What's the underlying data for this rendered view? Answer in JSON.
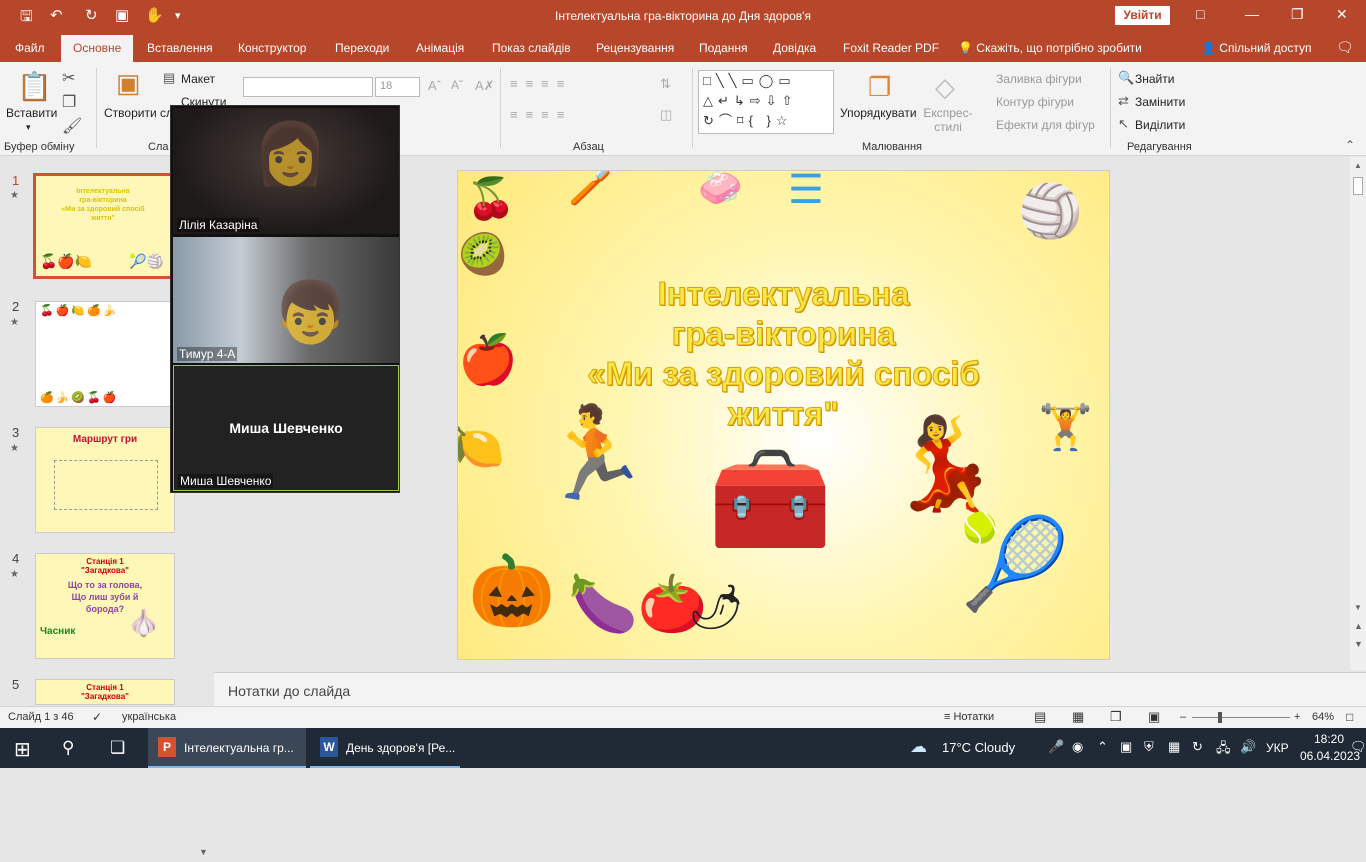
{
  "window": {
    "title": "Інтелектуальна гра-вікторина до Дня здоров'я",
    "signin": "Увійти"
  },
  "quick_access": [
    "save-icon",
    "undo-icon",
    "redo-icon",
    "start-slideshow-icon",
    "touch-mode-icon",
    "customize-icon"
  ],
  "menu": {
    "tabs": [
      "Файл",
      "Основне",
      "Вставлення",
      "Конструктор",
      "Переходи",
      "Анімація",
      "Показ слайдів",
      "Рецензування",
      "Подання",
      "Довідка",
      "Foxit Reader PDF"
    ],
    "active": "Основне",
    "tellme": "Скажіть, що потрібно зробити",
    "share": "Спільний доступ"
  },
  "ribbon": {
    "clipboard": {
      "label": "Буфер обміну",
      "paste": "Вставити"
    },
    "slides": {
      "label": "Сла",
      "new_slide": "Створити слайд",
      "layout": "Макет",
      "reset": "Скинути"
    },
    "font": {
      "size": "18"
    },
    "paragraph": {
      "label": "Абзац"
    },
    "drawing": {
      "label": "Малювання",
      "arrange": "Упорядкувати",
      "quick_styles": "Експрес-стилі",
      "fill": "Заливка фігури",
      "outline": "Контур фігури",
      "effects": "Ефекти для фігур"
    },
    "editing": {
      "label": "Редагування",
      "find": "Знайти",
      "replace": "Замінити",
      "select": "Виділити"
    }
  },
  "thumbnails": [
    {
      "num": "1",
      "active": true,
      "lines": [
        "Інтелектуальна",
        "гра-вікторина",
        "«Ми  за здоровий спосіб",
        "життя\""
      ]
    },
    {
      "num": "2",
      "active": false,
      "lines": []
    },
    {
      "num": "3",
      "active": false,
      "lines": [
        "Маршрут гри"
      ]
    },
    {
      "num": "4",
      "active": false,
      "lines": [
        "Станція 1",
        "\"Загадкова\"",
        "Що то за голова,",
        "Що лиш зуби й",
        "борода?",
        "Часник"
      ]
    },
    {
      "num": "5",
      "active": false,
      "lines": [
        "Станція 1",
        "\"Загадкова\""
      ]
    }
  ],
  "slide": {
    "title_lines": [
      "Інтелектуальна",
      "гра-вікторина",
      "«Ми  за здоровий спосіб",
      "життя\""
    ]
  },
  "video": {
    "participants": [
      {
        "name": "Лілія Казаріна"
      },
      {
        "name": "Тимур 4-А"
      },
      {
        "name": "Миша Шевченко",
        "center": "Миша Шевченко"
      }
    ]
  },
  "notes": {
    "placeholder": "Нотатки до слайда"
  },
  "status": {
    "slide": "Слайд 1 з 46",
    "language": "українська",
    "notes": "Нотатки",
    "zoom": "64%"
  },
  "taskbar": {
    "apps": [
      {
        "label": "Інтелектуальна гр..."
      },
      {
        "label": "День здоров'я [Ре..."
      }
    ],
    "weather": "17°C  Cloudy",
    "lang": "УКР",
    "time": "18:20",
    "date": "06.04.2023"
  }
}
